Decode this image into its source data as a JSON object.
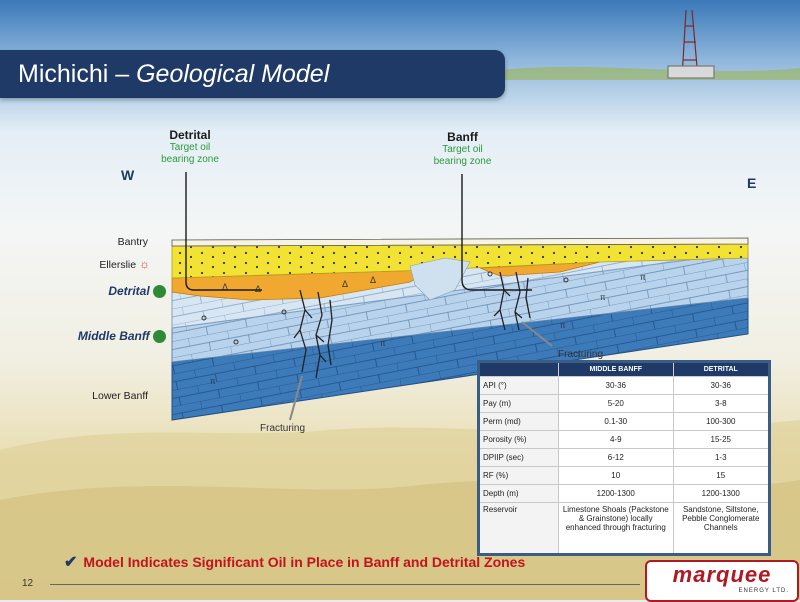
{
  "slide": {
    "title_main": "Michichi – ",
    "title_italic": "Geological Model",
    "page_number": "12"
  },
  "wells": [
    {
      "name": "Detrital",
      "sub1": "Target oil",
      "sub2": "bearing zone"
    },
    {
      "name": "Banff",
      "sub1": "Target oil",
      "sub2": "bearing zone"
    }
  ],
  "directions": {
    "west": "W",
    "east": "E"
  },
  "strata": {
    "bantry": "Bantry",
    "ellerslie": "Ellerslie",
    "detrital": "Detrital",
    "middle_banff": "Middle Banff",
    "lower_banff": "Lower Banff"
  },
  "annotations": {
    "fracturing_right": "Fracturing",
    "fracturing_left": "Fracturing"
  },
  "table": {
    "headers": [
      "",
      "MIDDLE BANFF",
      "DETRITAL"
    ],
    "rows": [
      [
        "API (°)",
        "30-36",
        "30-36"
      ],
      [
        "Pay (m)",
        "5-20",
        "3-8"
      ],
      [
        "Perm (md)",
        "0.1-30",
        "100-300"
      ],
      [
        "Porosity (%)",
        "4-9",
        "15-25"
      ],
      [
        "DPIIP (sec)",
        "6-12",
        "1-3"
      ],
      [
        "RF (%)",
        "10",
        "15"
      ],
      [
        "Depth (m)",
        "1200-1300",
        "1200-1300"
      ],
      [
        "Reservoir",
        "Limestone Shoals (Packstone & Grainstone) locally enhanced through fracturing",
        "Sandstone, Siltstone, Pebble Conglomerate Channels"
      ]
    ]
  },
  "bullet": "Model Indicates Significant Oil in Place in Banff and Detrital Zones",
  "logo": {
    "name": "marquee",
    "sub": "ENERGY LTD."
  },
  "colors": {
    "title_bar": "#1f3a66",
    "ellerslie_yellow": "#f2e233",
    "detrital_orange": "#f0a830",
    "banff_blue": "#3f7fc0",
    "lower_banff_blue": "#3d7ab9",
    "bullet_red": "#c4121e",
    "zone_green": "#2f8a36"
  }
}
